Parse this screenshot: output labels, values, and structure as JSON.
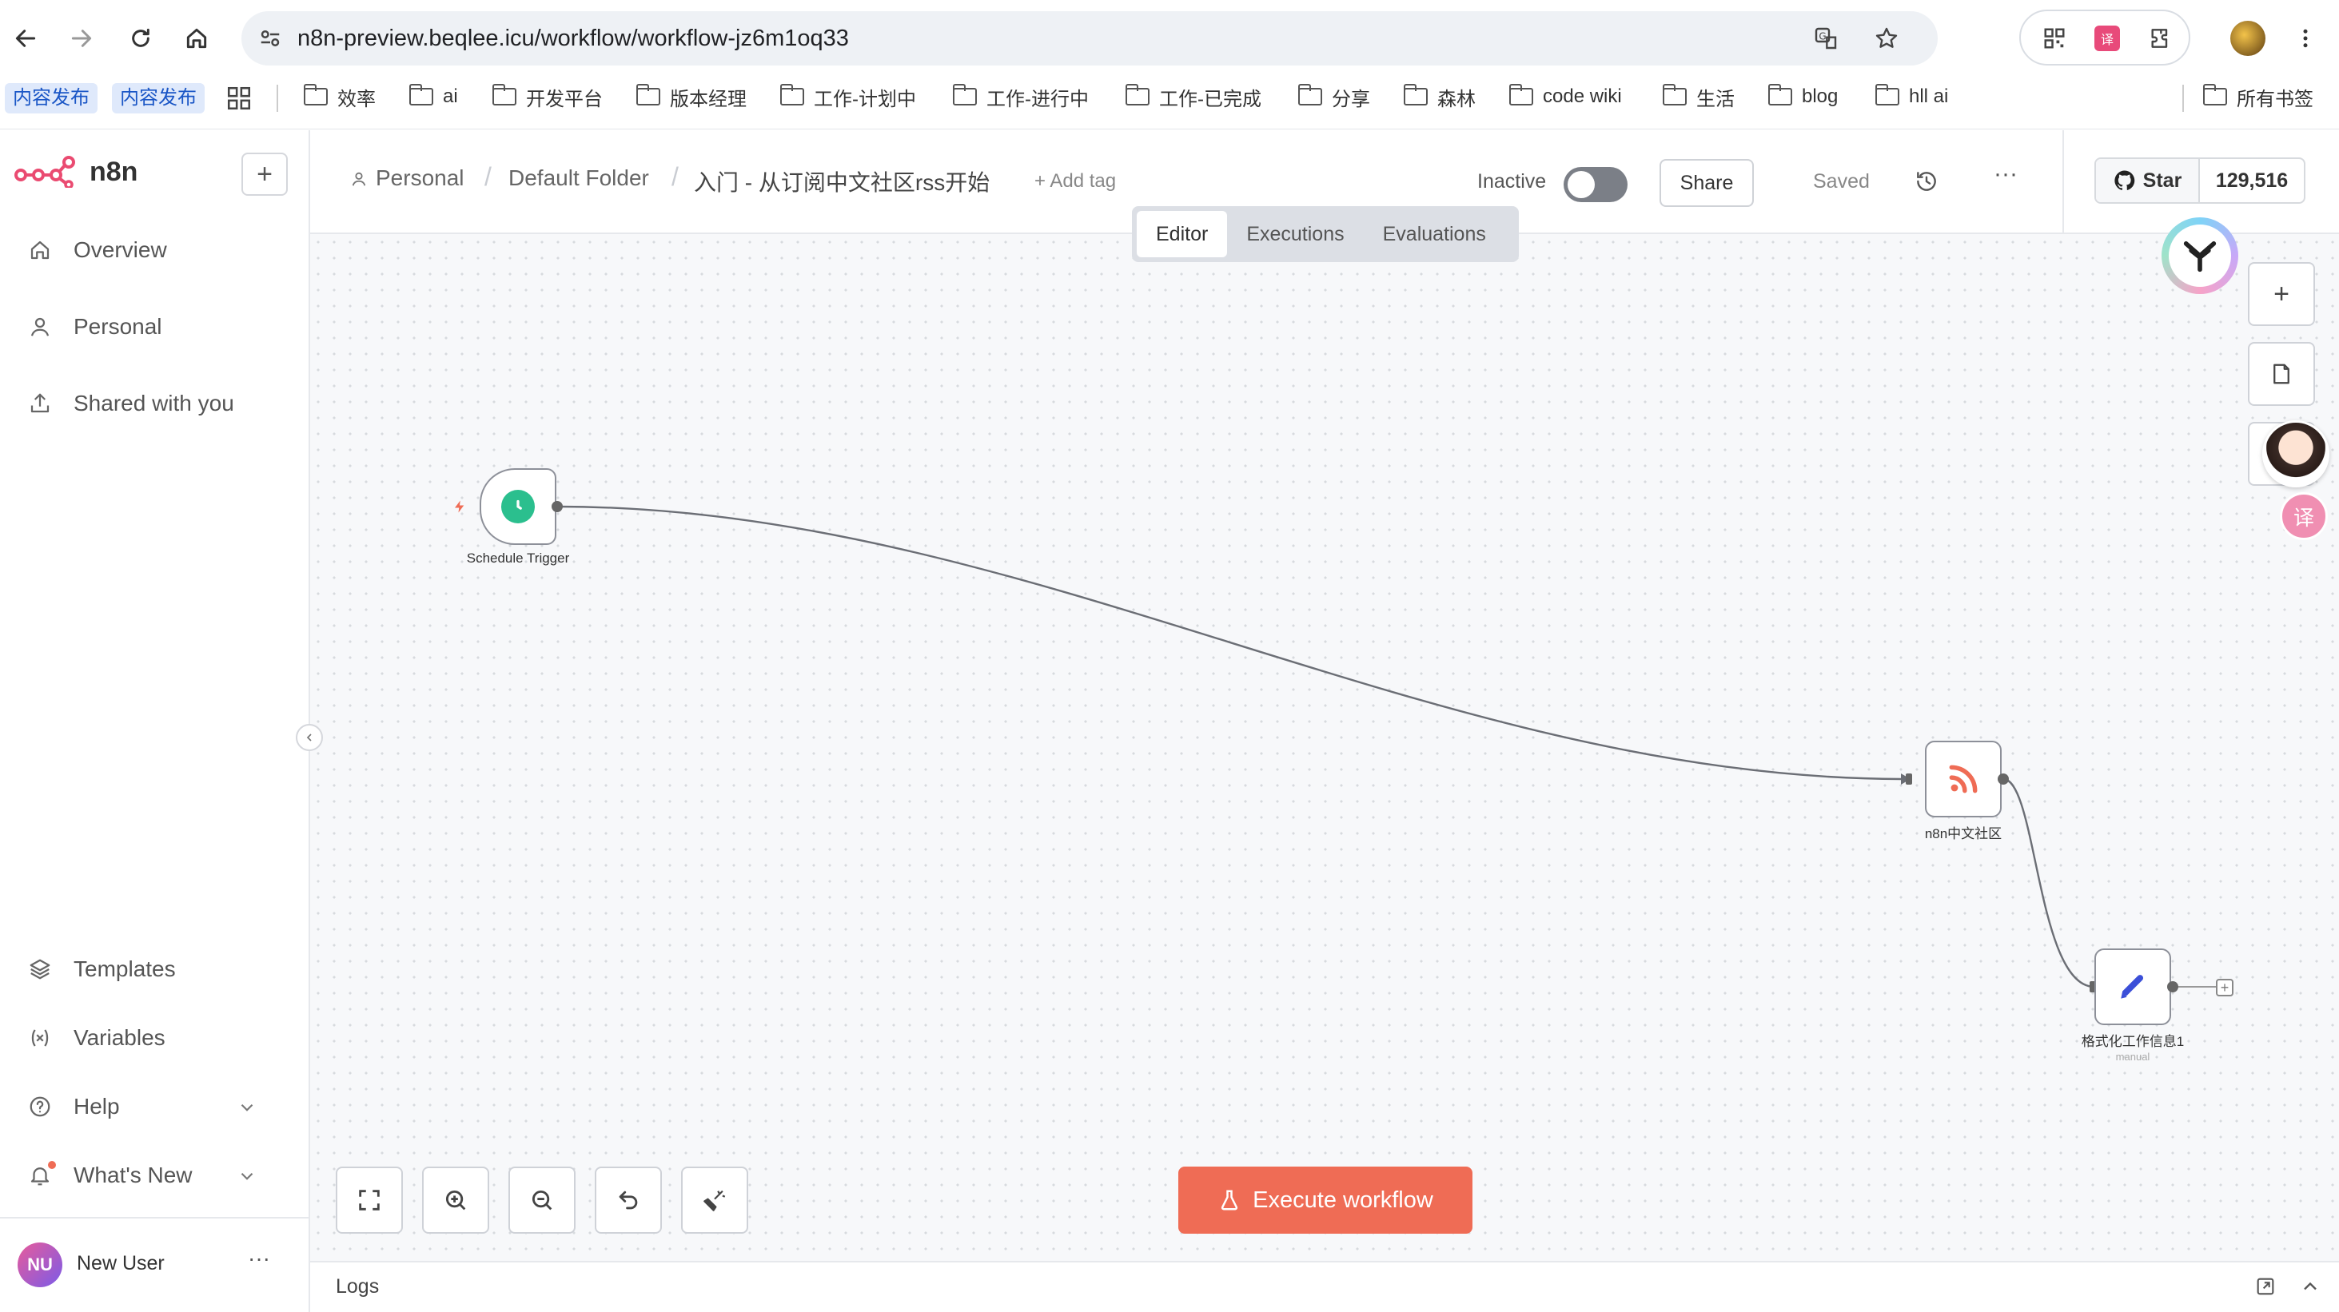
{
  "browser": {
    "url": "n8n-preview.beqlee.icu/workflow/workflow-jz6m1oq33",
    "bookmarks_chips": [
      "内容发布",
      "内容发布"
    ],
    "bookmarks": [
      "效率",
      "ai",
      "开发平台",
      "版本经理",
      "工作-计划中",
      "工作-进行中",
      "工作-已完成",
      "分享",
      "森林",
      "code wiki",
      "生活",
      "blog",
      "hll ai"
    ],
    "all_bookmarks": "所有书签"
  },
  "sidebar": {
    "logo_text": "n8n",
    "new_label": "+",
    "nav": [
      {
        "label": "Overview",
        "icon": "home-icon"
      },
      {
        "label": "Personal",
        "icon": "user-icon"
      },
      {
        "label": "Shared with you",
        "icon": "share-icon"
      }
    ],
    "bottom_nav": [
      {
        "label": "Templates",
        "icon": "templates-icon"
      },
      {
        "label": "Variables",
        "icon": "variables-icon"
      },
      {
        "label": "Help",
        "icon": "help-icon"
      },
      {
        "label": "What's New",
        "icon": "bell-icon"
      }
    ],
    "user": {
      "initials": "NU",
      "name": "New User",
      "more": "···"
    }
  },
  "header": {
    "breadcrumb": [
      "Personal",
      "Default Folder",
      "入门 - 从订阅中文社区rss开始"
    ],
    "add_tag": "+ Add tag",
    "status": "Inactive",
    "share": "Share",
    "saved": "Saved",
    "more": "···",
    "github": {
      "star": "Star",
      "count": "129,516"
    }
  },
  "tabs": [
    {
      "label": "Editor",
      "active": true
    },
    {
      "label": "Executions",
      "active": false
    },
    {
      "label": "Evaluations",
      "active": false
    }
  ],
  "workflow": {
    "nodes": [
      {
        "label": "Schedule Trigger",
        "icon": "clock-icon",
        "color": "#2bbf8e"
      },
      {
        "label": "n8n中文社区",
        "icon": "rss-icon",
        "color": "#ef6c55"
      },
      {
        "label": "格式化工作信息1",
        "sub": "manual",
        "icon": "pencil-icon",
        "color": "#3b4fd8"
      }
    ]
  },
  "execute_button": "Execute workflow",
  "logs": {
    "label": "Logs"
  },
  "colors": {
    "accent": "#ef6c55",
    "trigger": "#2bbf8e",
    "edit": "#3b4fd8"
  }
}
